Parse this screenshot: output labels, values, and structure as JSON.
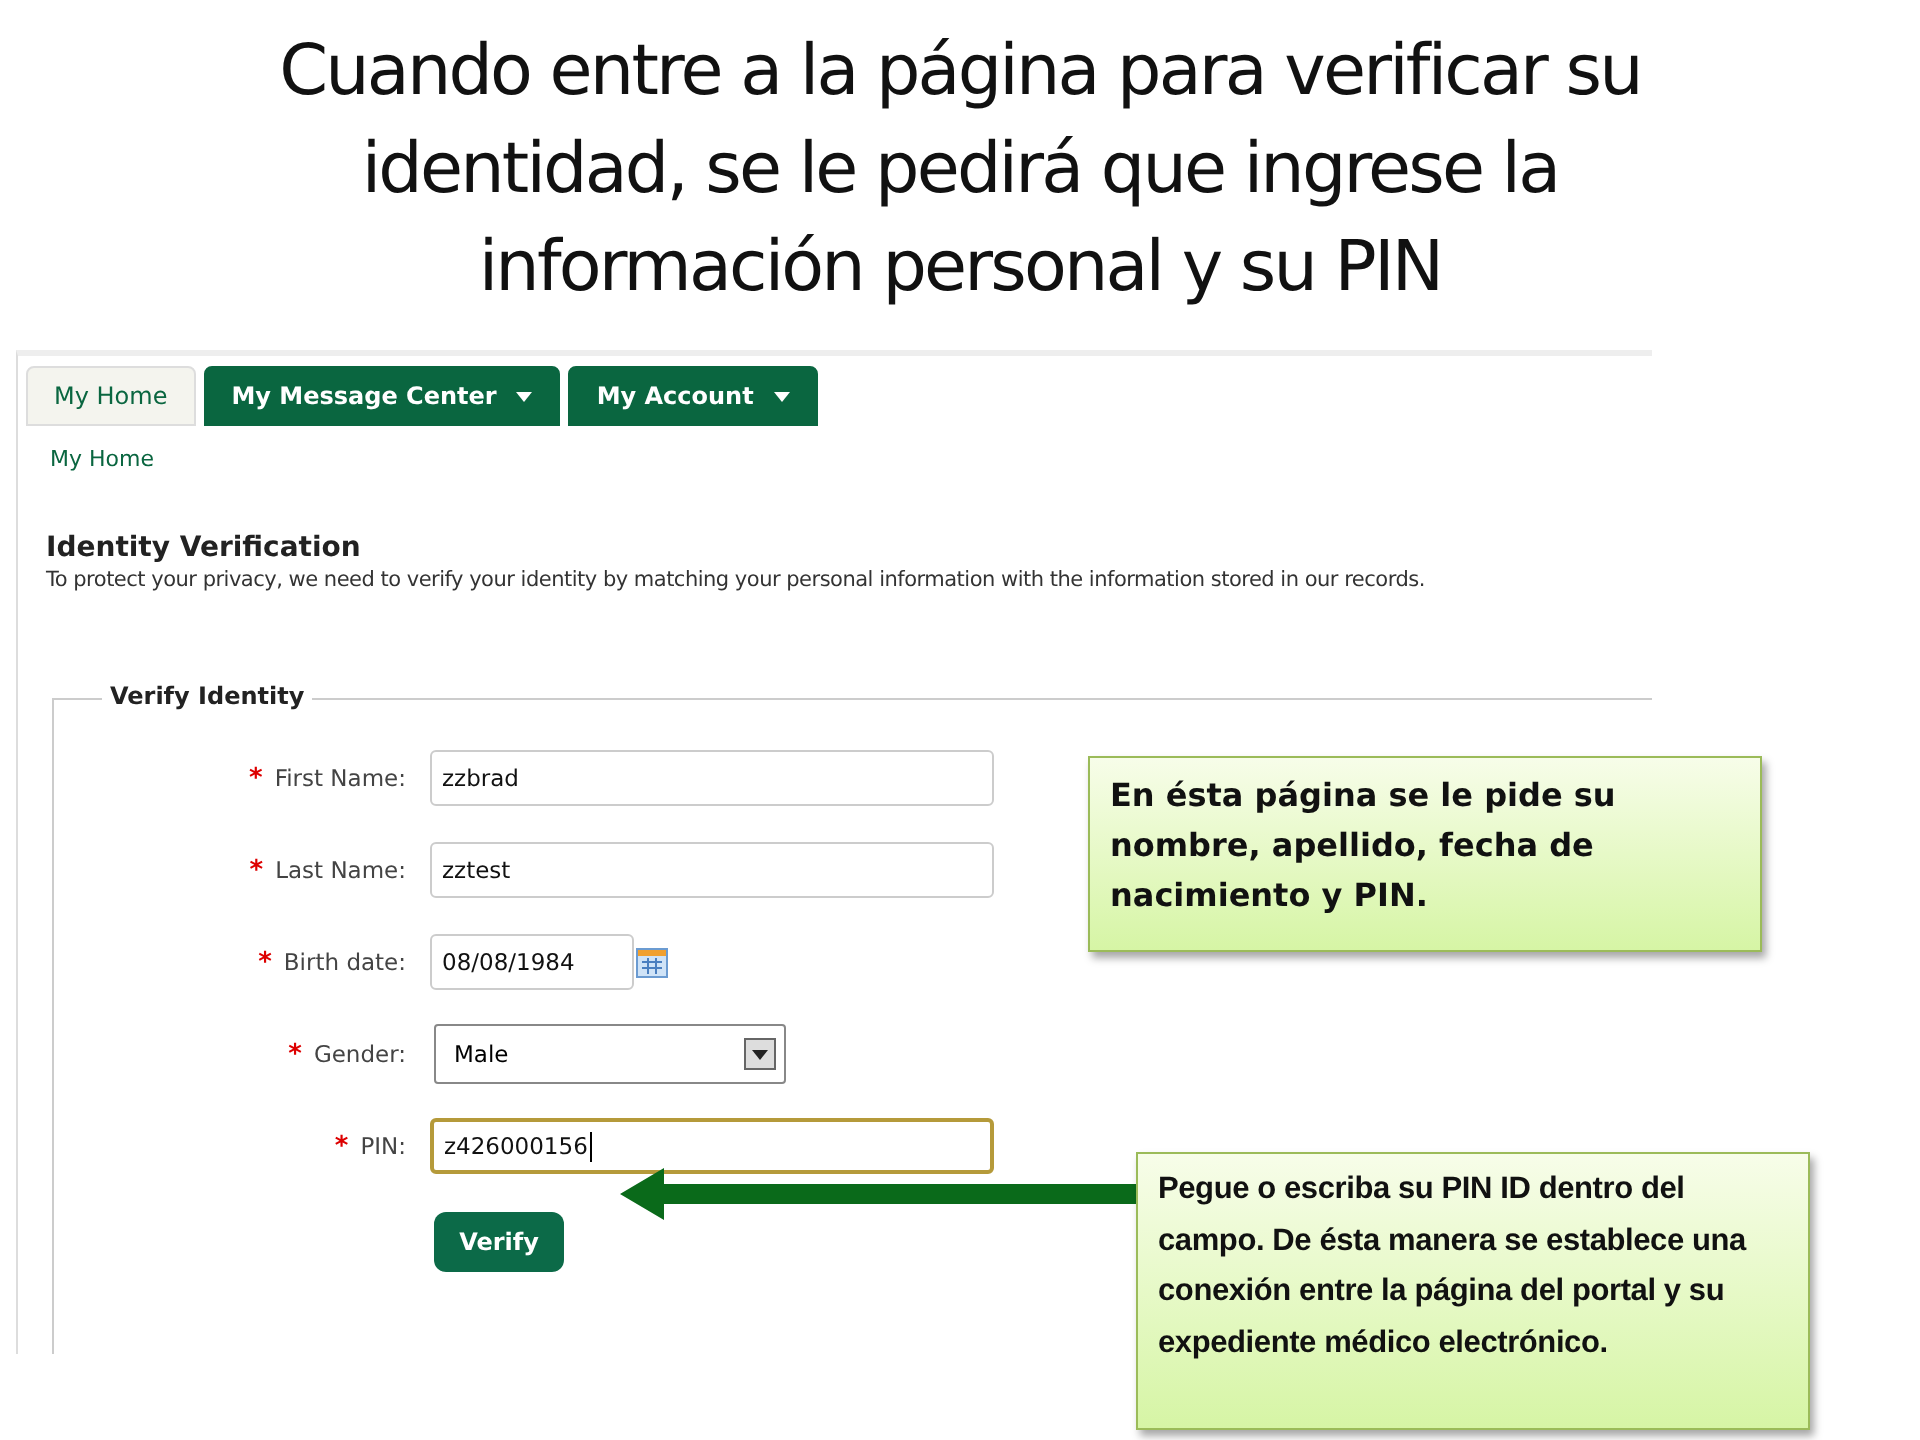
{
  "slide_title": "Cuando entre a la página para verificar su identidad, se le pedirá que ingrese la información personal y su PIN",
  "tabs": [
    {
      "label": "My Home",
      "selected": true,
      "has_menu": false
    },
    {
      "label": "My Message Center",
      "selected": false,
      "has_menu": true
    },
    {
      "label": "My Account",
      "selected": false,
      "has_menu": true
    }
  ],
  "breadcrumb": "My Home",
  "heading": "Identity Verification",
  "description": "To protect your privacy, we need to verify your identity by matching your personal information with the information stored in our records.",
  "fieldset_legend": "Verify Identity",
  "fields": [
    {
      "kind": "text",
      "marker": "*",
      "label": "First Name:",
      "value": "zzbrad",
      "focused": false
    },
    {
      "kind": "text",
      "marker": "*",
      "label": "Last Name:",
      "value": "zztest",
      "focused": false
    },
    {
      "kind": "date",
      "marker": "*",
      "label": "Birth date:",
      "value": "08/08/1984",
      "focused": false
    },
    {
      "kind": "select",
      "marker": "*",
      "label": "Gender:",
      "value": "Male",
      "focused": false
    },
    {
      "kind": "text",
      "marker": "*",
      "label": "PIN:",
      "value": "z426000156",
      "focused": true
    }
  ],
  "verify_button": "Verify",
  "callouts": [
    {
      "text": "En ésta página se le pide su nombre, apellido, fecha de nacimiento y PIN.",
      "kind": "large"
    },
    {
      "text": "Pegue o escriba su PIN ID dentro del campo. De ésta manera se establece una conexión entre la página del portal y su expediente médico electrónico.",
      "kind": "small"
    }
  ]
}
